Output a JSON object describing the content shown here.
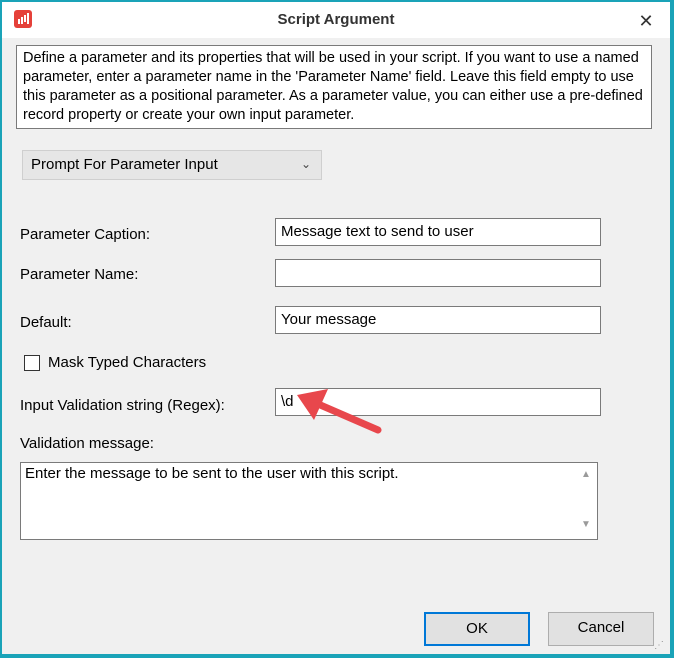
{
  "window": {
    "title": "Script Argument",
    "close_icon": "close-icon",
    "accent": "#1aa3b8"
  },
  "description": "Define a parameter and its properties that will be used in your script. If you want to use a named parameter, enter a parameter name in the 'Parameter Name' field. Leave this field empty to use this parameter as a positional parameter. As a parameter value, you can either use a pre-defined record property or create your own input parameter.",
  "mode_select": {
    "selected": "Prompt For Parameter Input",
    "icon": "chevron-down-icon"
  },
  "form": {
    "caption_label": "Parameter Caption:",
    "caption_value": "Message text to send to user",
    "name_label": "Parameter Name:",
    "name_value": "",
    "default_label": "Default:",
    "default_value": "Your message",
    "mask_label": "Mask Typed Characters",
    "mask_checked": false,
    "regex_label": "Input Validation string (Regex):",
    "regex_value": "\\d",
    "validation_label": "Validation message:",
    "validation_value": "Enter the message to be sent to the user with this script."
  },
  "buttons": {
    "ok": "OK",
    "cancel": "Cancel"
  },
  "annotation": {
    "color": "#e8474c",
    "icon": "red-arrow-icon"
  }
}
